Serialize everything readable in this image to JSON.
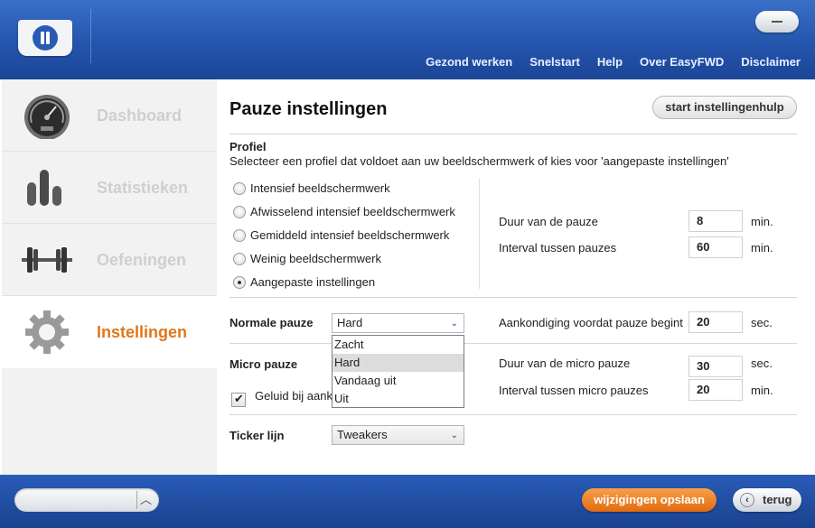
{
  "header": {
    "nav": [
      "Gezond werken",
      "Snelstart",
      "Help",
      "Over EasyFWD",
      "Disclaimer"
    ]
  },
  "sidebar": {
    "items": [
      {
        "label": "Dashboard",
        "icon": "speedometer-icon"
      },
      {
        "label": "Statistieken",
        "icon": "bar-chart-icon"
      },
      {
        "label": "Oefeningen",
        "icon": "dumbbell-icon"
      },
      {
        "label": "Instellingen",
        "icon": "gear-icon",
        "active": true
      }
    ]
  },
  "main": {
    "title": "Pauze instellingen",
    "wizard_button": "start instellingenhulp",
    "profile": {
      "heading": "Profiel",
      "description": "Selecteer een profiel dat voldoet aan uw beeldschermwerk of kies voor 'aangepaste instellingen'",
      "options": [
        "Intensief beeldschermwerk",
        "Afwisselend intensief beeldschermwerk",
        "Gemiddeld intensief beeldschermwerk",
        "Weinig beeldschermwerk",
        "Aangepaste instellingen"
      ],
      "selected_index": 4
    },
    "pause": {
      "duration_label": "Duur van de pauze",
      "duration_value": "8",
      "duration_unit": "min.",
      "interval_label": "Interval tussen pauzes",
      "interval_value": "60",
      "interval_unit": "min."
    },
    "normal_pause": {
      "label": "Normale pauze",
      "selected": "Hard",
      "options": [
        "Zacht",
        "Hard",
        "Vandaag uit",
        "Uit"
      ],
      "highlighted": "Hard",
      "announce_label": "Aankondiging voordat pauze begint",
      "announce_value": "20",
      "announce_unit": "sec."
    },
    "micro_pause": {
      "label": "Micro pauze",
      "duration_label": "Duur van de micro pauze",
      "duration_value": "30",
      "duration_unit": "sec.",
      "interval_label": "Interval tussen micro pauzes",
      "interval_value": "20",
      "interval_unit": "min."
    },
    "sound_checkbox": {
      "label": "Geluid bij aank",
      "checked": true
    },
    "ticker": {
      "label": "Ticker lijn",
      "selected": "Tweakers"
    }
  },
  "footer": {
    "save_button": "wijzigingen opslaan",
    "back_button": "terug"
  },
  "colors": {
    "accent": "#e0771c",
    "header_blue": "#2455ad"
  }
}
